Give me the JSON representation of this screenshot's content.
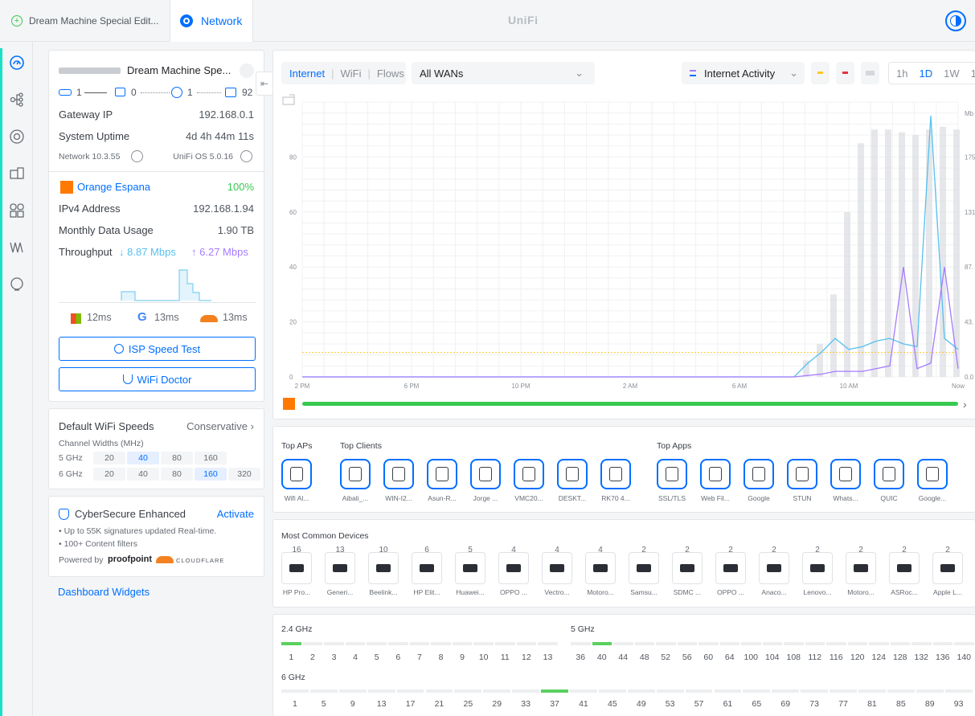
{
  "topbar": {
    "device_tab": "Dream Machine Special Edit...",
    "app_tab": "Network",
    "brand": "UniFi"
  },
  "sidebar": {
    "icons": [
      "dashboard-icon",
      "topology-icon",
      "devices-icon",
      "clients-icon",
      "ports-icon",
      "insights-icon",
      "alerts-icon"
    ]
  },
  "gateway": {
    "name": "Dream Machine Spe...",
    "counts": {
      "wired": "1",
      "aps": "0",
      "wifi": "1",
      "clients": "92"
    },
    "gateway_ip_label": "Gateway IP",
    "gateway_ip": "192.168.0.1",
    "uptime_label": "System Uptime",
    "uptime": "4d 4h 44m 11s",
    "network_version": "Network 10.3.55",
    "os_version": "UniFi OS 5.0.16",
    "isp_name": "Orange Espana",
    "isp_health": "100%",
    "ipv4_label": "IPv4 Address",
    "ipv4": "192.168.1.94",
    "data_usage_label": "Monthly Data Usage",
    "data_usage": "1.90 TB",
    "throughput_label": "Throughput",
    "down": "8.87 Mbps",
    "up": "6.27 Mbps",
    "latency": [
      {
        "icon": "microsoft-icon",
        "value": "12ms"
      },
      {
        "icon": "google-icon",
        "value": "13ms"
      },
      {
        "icon": "cloudflare-icon",
        "value": "13ms"
      }
    ],
    "speed_test": "ISP Speed Test",
    "wifi_doctor": "WiFi Doctor"
  },
  "wifi_speeds": {
    "title": "Default WiFi Speeds",
    "mode": "Conservative",
    "subtitle": "Channel Widths (MHz)",
    "rows": [
      {
        "band": "5 GHz",
        "options": [
          "20",
          "40",
          "80",
          "160"
        ],
        "selected": "40"
      },
      {
        "band": "6 GHz",
        "options": [
          "20",
          "40",
          "80",
          "160",
          "320"
        ],
        "selected": "160"
      }
    ]
  },
  "cybersecure": {
    "title": "CyberSecure Enhanced",
    "action": "Activate",
    "bullets": [
      "Up to 55K signatures updated Real-time.",
      "100+ Content filters"
    ],
    "powered_by": "Powered by",
    "partner1": "proofpoint",
    "partner2": "CLOUDFLARE"
  },
  "dashboard_widgets": "Dashboard Widgets",
  "chart_toolbar": {
    "tabs": [
      "Internet",
      "WiFi",
      "Flows"
    ],
    "active_tab": "Internet",
    "wan_select": "All WANs",
    "activity_select": "Internet Activity",
    "ranges": [
      "1h",
      "1D",
      "1W",
      "1"
    ],
    "active_range": "1D"
  },
  "chart_data": {
    "type": "line",
    "x_ticks": [
      "2 PM",
      "6 PM",
      "10 PM",
      "2 AM",
      "6 AM",
      "10 AM",
      "Now"
    ],
    "y_left_ticks": [
      "0",
      "20",
      "40",
      "60",
      "80"
    ],
    "y_right_ticks": [
      "0.0",
      "43.",
      "87.",
      "131",
      "175"
    ],
    "y_right_unit": "Mb",
    "ylim": [
      0,
      100
    ],
    "threshold": 8.87,
    "x": [
      0,
      0.5,
      1,
      1.5,
      2,
      2.5,
      3,
      3.5,
      4,
      4.5,
      5,
      5.5,
      6,
      6.5,
      7,
      7.5,
      8,
      8.5,
      9,
      9.5,
      10,
      10.5,
      11,
      11.5,
      12,
      12.5,
      13,
      13.5,
      14,
      14.5,
      15,
      15.5,
      16,
      16.5,
      17,
      17.5,
      18,
      18.5,
      19,
      19.5,
      20,
      20.5,
      21,
      21.5,
      22,
      22.5,
      23,
      23.5,
      24
    ],
    "series": [
      {
        "values": [
          0,
          0,
          0,
          0,
          0,
          0,
          0,
          0,
          0,
          0,
          0,
          0,
          0,
          0,
          0,
          0,
          0,
          0,
          0,
          0,
          0,
          0,
          0,
          0,
          0,
          0,
          0,
          0,
          0,
          0,
          0,
          0,
          0,
          0,
          0,
          0,
          0,
          5,
          9,
          14,
          10,
          11,
          13,
          14,
          12,
          11,
          95,
          14,
          10
        ]
      },
      {
        "values": [
          0,
          0,
          0,
          0,
          0,
          0,
          0,
          0,
          0,
          0,
          0,
          0,
          0,
          0,
          0,
          0,
          0,
          0,
          0,
          0,
          0,
          0,
          0,
          0,
          0,
          0,
          0,
          0,
          0,
          0,
          0,
          0,
          0,
          0,
          0,
          0,
          0,
          0.5,
          1,
          2,
          2,
          2,
          3,
          4,
          40,
          3,
          5,
          40,
          3
        ]
      }
    ],
    "bar_values": [
      0,
      0,
      0,
      0,
      0,
      0,
      0,
      0,
      0,
      0,
      0,
      0,
      0,
      0,
      0,
      0,
      0,
      0,
      0,
      0,
      0,
      0,
      0,
      0,
      0,
      0,
      0,
      0,
      0,
      0,
      0,
      0,
      0,
      0,
      0,
      0,
      0,
      6,
      12,
      30,
      60,
      85,
      90,
      90,
      89,
      88,
      90,
      91,
      90
    ]
  },
  "colors": {
    "accent": "#006fff",
    "download": "#56c0f0",
    "upload": "#a77bff",
    "good": "#38c951",
    "isp": "#ff7900"
  },
  "top_lists": {
    "aps_title": "Top APs",
    "clients_title": "Top Clients",
    "apps_title": "Top Apps",
    "aps": [
      {
        "label": "Wifi Al...",
        "icon": "access-point-icon"
      }
    ],
    "clients": [
      {
        "label": "Aibali_...",
        "icon": "speaker-icon"
      },
      {
        "label": "WIN-I2...",
        "icon": "desktop-icon"
      },
      {
        "label": "Asun-R...",
        "icon": "phone-icon"
      },
      {
        "label": "Jorge ...",
        "icon": "monitor-icon"
      },
      {
        "label": "VMC20...",
        "icon": "camera-icon"
      },
      {
        "label": "DESKT...",
        "icon": "pc-icon"
      },
      {
        "label": "RK70 4...",
        "icon": "keyboard-icon"
      }
    ],
    "apps": [
      {
        "label": "SSL/TLS",
        "icon": "shield-icon"
      },
      {
        "label": "Web Fil...",
        "icon": "web-file-icon"
      },
      {
        "label": "Google",
        "icon": "google-icon"
      },
      {
        "label": "STUN",
        "icon": "stun-icon"
      },
      {
        "label": "Whats...",
        "icon": "whatsapp-icon"
      },
      {
        "label": "QUIC",
        "icon": "quic-icon"
      },
      {
        "label": "Google...",
        "icon": "chrome-icon"
      }
    ]
  },
  "common_devices": {
    "title": "Most Common Devices",
    "items": [
      {
        "count": "16",
        "label": "HP Pro..."
      },
      {
        "count": "13",
        "label": "Generi..."
      },
      {
        "count": "10",
        "label": "Beelink..."
      },
      {
        "count": "6",
        "label": "HP Elit..."
      },
      {
        "count": "5",
        "label": "Huawei..."
      },
      {
        "count": "4",
        "label": "OPPO ..."
      },
      {
        "count": "4",
        "label": "Vectro..."
      },
      {
        "count": "4",
        "label": "Motoro..."
      },
      {
        "count": "2",
        "label": "Samsu..."
      },
      {
        "count": "2",
        "label": "SDMC ..."
      },
      {
        "count": "2",
        "label": "OPPO ..."
      },
      {
        "count": "2",
        "label": "Anaco..."
      },
      {
        "count": "2",
        "label": "Lenovo..."
      },
      {
        "count": "2",
        "label": "Motoro..."
      },
      {
        "count": "2",
        "label": "ASRoc..."
      },
      {
        "count": "2",
        "label": "Apple L..."
      }
    ]
  },
  "channels": {
    "band24_label": "2.4 GHz",
    "band24": [
      "1",
      "2",
      "3",
      "4",
      "5",
      "6",
      "7",
      "8",
      "9",
      "10",
      "11",
      "12",
      "13"
    ],
    "band24_active": "1",
    "band5_label": "5 GHz",
    "band5": [
      "36",
      "40",
      "44",
      "48",
      "52",
      "56",
      "60",
      "64",
      "100",
      "104",
      "108",
      "112",
      "116",
      "120",
      "124",
      "128",
      "132",
      "136",
      "140"
    ],
    "band5_active": "40",
    "band6_label": "6 GHz",
    "band6": [
      "1",
      "5",
      "9",
      "13",
      "17",
      "21",
      "25",
      "29",
      "33",
      "37",
      "41",
      "45",
      "49",
      "53",
      "57",
      "61",
      "65",
      "69",
      "73",
      "77",
      "81",
      "85",
      "89",
      "93"
    ],
    "band6_active": "37"
  }
}
